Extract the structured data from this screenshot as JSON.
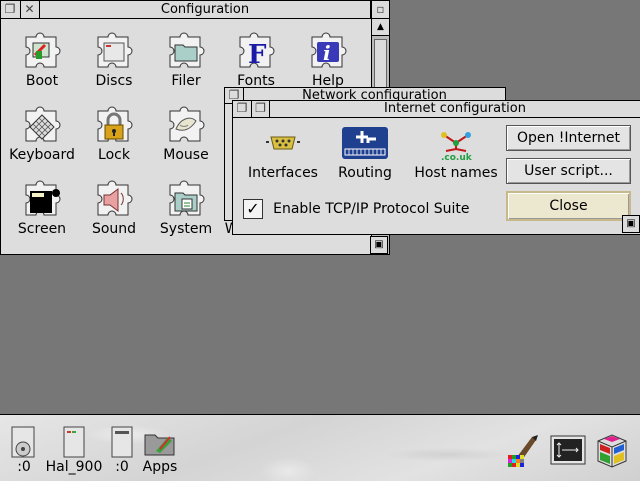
{
  "config_window": {
    "title": "Configuration",
    "icons": [
      {
        "label": "Boot",
        "icon": "boot-icon"
      },
      {
        "label": "Discs",
        "icon": "discs-icon"
      },
      {
        "label": "Filer",
        "icon": "filer-icon"
      },
      {
        "label": "Fonts",
        "icon": "fonts-icon"
      },
      {
        "label": "Help",
        "icon": "help-icon"
      },
      {
        "label": "Keyboard",
        "icon": "keyboard-icon"
      },
      {
        "label": "Lock",
        "icon": "lock-icon"
      },
      {
        "label": "Mouse",
        "icon": "mouse-icon"
      },
      {
        "label": "Screen",
        "icon": "screen-icon"
      },
      {
        "label": "Sound",
        "icon": "sound-icon"
      },
      {
        "label": "System",
        "icon": "system-icon"
      },
      {
        "label": "Windows",
        "icon": "windows-icon"
      }
    ]
  },
  "network_window": {
    "title": "Network configuration"
  },
  "internet_window": {
    "title": "Internet configuration",
    "icons": [
      {
        "label": "Interfaces",
        "icon": "interfaces-icon"
      },
      {
        "label": "Routing",
        "icon": "routing-icon"
      },
      {
        "label": "Host names",
        "icon": "host-names-icon"
      }
    ],
    "checkbox_label": "Enable TCP/IP Protocol Suite",
    "checkbox_checked": true,
    "buttons": {
      "open_internet": "Open !Internet",
      "user_script": "User script...",
      "close": "Close"
    }
  },
  "iconbar": {
    "left": [
      {
        "label": ":0",
        "icon": "floppy-drive-icon"
      },
      {
        "label": "Hal_900",
        "icon": "hard-drive-icon"
      },
      {
        "label": ":0",
        "icon": "ram-disc-icon"
      },
      {
        "label": "Apps",
        "icon": "apps-folder-icon"
      }
    ],
    "right": [
      {
        "icon": "paint-palette-icon"
      },
      {
        "icon": "display-manager-icon"
      },
      {
        "icon": "task-manager-icon"
      }
    ]
  }
}
